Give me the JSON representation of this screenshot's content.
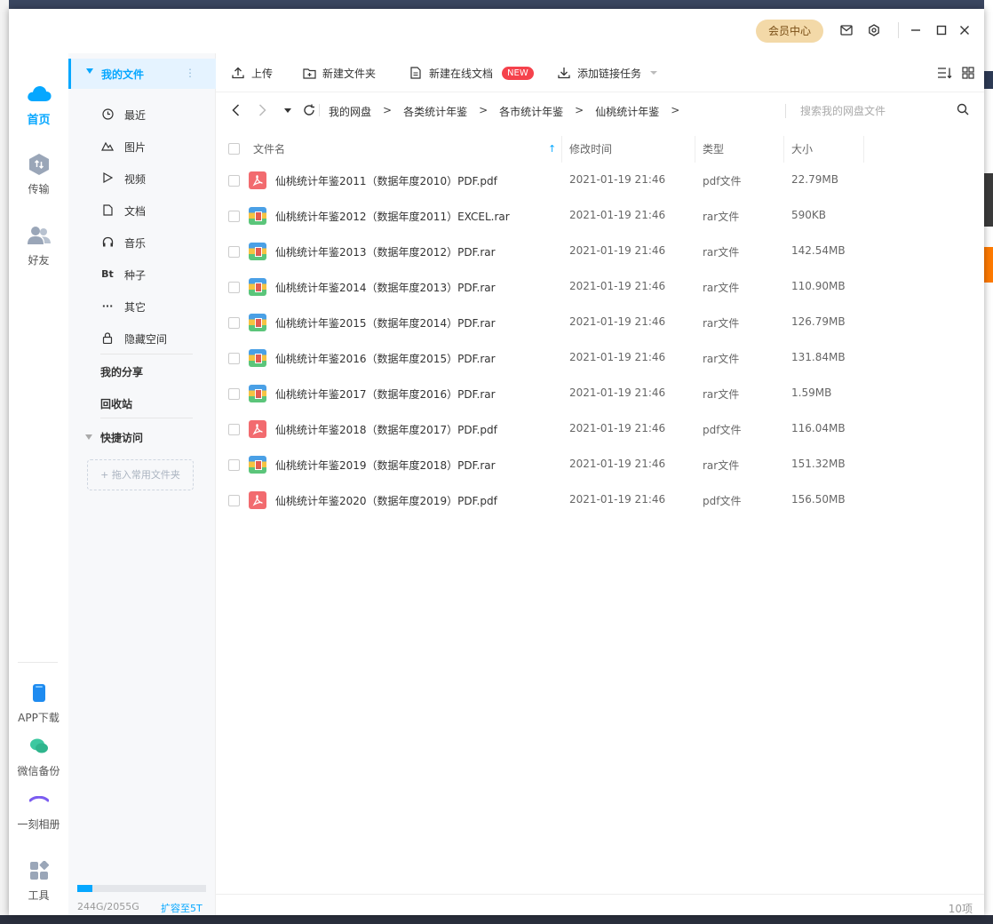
{
  "titlebar": {
    "vip_label": "会员中心"
  },
  "leftnav": {
    "items": [
      {
        "label": "首页",
        "icon": "cloud-icon"
      },
      {
        "label": "传输",
        "icon": "transfer-icon"
      },
      {
        "label": "好友",
        "icon": "friends-icon"
      }
    ],
    "bottom_items": [
      {
        "label": "APP下载",
        "icon": "phone-icon"
      },
      {
        "label": "微信备份",
        "icon": "wechat-icon"
      },
      {
        "label": "一刻相册",
        "icon": "album-icon"
      },
      {
        "label": "工具",
        "icon": "tools-icon"
      }
    ]
  },
  "sidebar": {
    "my_files": "我的文件",
    "more": "⋮",
    "categories": [
      {
        "label": "最近",
        "icon": "clock-icon"
      },
      {
        "label": "图片",
        "icon": "image-icon"
      },
      {
        "label": "视频",
        "icon": "video-icon"
      },
      {
        "label": "文档",
        "icon": "document-icon"
      },
      {
        "label": "音乐",
        "icon": "headphones-icon"
      },
      {
        "label": "种子",
        "icon": "bt-icon",
        "glyph": "Bt"
      },
      {
        "label": "其它",
        "icon": "more-icon",
        "glyph": "···"
      },
      {
        "label": "隐藏空间",
        "icon": "lock-icon"
      }
    ],
    "my_share": "我的分享",
    "recycle": "回收站",
    "quick_access": "快捷访问",
    "add_fav": "+ 拖入常用文件夹",
    "quota": {
      "used_text": "244G/2055G",
      "used_fraction": 0.119,
      "upgrade": "扩容至5T"
    }
  },
  "toolbar": {
    "upload": "上传",
    "new_folder": "新建文件夹",
    "new_online_doc": "新建在线文档",
    "new_badge": "NEW",
    "add_link_task": "添加链接任务"
  },
  "path": {
    "crumbs": [
      "我的网盘",
      "各类统计年鉴",
      "各市统计年鉴",
      "仙桃统计年鉴"
    ],
    "search_placeholder": "搜索我的网盘文件"
  },
  "table": {
    "headers": {
      "name": "文件名",
      "modified": "修改时间",
      "type": "类型",
      "size": "大小"
    },
    "rows": [
      {
        "name": "仙桃统计年鉴2011（数据年度2010）PDF.pdf",
        "modified": "2021-01-19 21:46",
        "type": "pdf文件",
        "size": "22.79MB",
        "kind": "pdf"
      },
      {
        "name": "仙桃统计年鉴2012（数据年度2011）EXCEL.rar",
        "modified": "2021-01-19 21:46",
        "type": "rar文件",
        "size": "590KB",
        "kind": "rar"
      },
      {
        "name": "仙桃统计年鉴2013（数据年度2012）PDF.rar",
        "modified": "2021-01-19 21:46",
        "type": "rar文件",
        "size": "142.54MB",
        "kind": "rar"
      },
      {
        "name": "仙桃统计年鉴2014（数据年度2013）PDF.rar",
        "modified": "2021-01-19 21:46",
        "type": "rar文件",
        "size": "110.90MB",
        "kind": "rar"
      },
      {
        "name": "仙桃统计年鉴2015（数据年度2014）PDF.rar",
        "modified": "2021-01-19 21:46",
        "type": "rar文件",
        "size": "126.79MB",
        "kind": "rar"
      },
      {
        "name": "仙桃统计年鉴2016（数据年度2015）PDF.rar",
        "modified": "2021-01-19 21:46",
        "type": "rar文件",
        "size": "131.84MB",
        "kind": "rar"
      },
      {
        "name": "仙桃统计年鉴2017（数据年度2016）PDF.rar",
        "modified": "2021-01-19 21:46",
        "type": "rar文件",
        "size": "1.59MB",
        "kind": "rar"
      },
      {
        "name": "仙桃统计年鉴2018（数据年度2017）PDF.pdf",
        "modified": "2021-01-19 21:46",
        "type": "pdf文件",
        "size": "116.04MB",
        "kind": "pdf"
      },
      {
        "name": "仙桃统计年鉴2019（数据年度2018）PDF.rar",
        "modified": "2021-01-19 21:46",
        "type": "rar文件",
        "size": "151.32MB",
        "kind": "rar"
      },
      {
        "name": "仙桃统计年鉴2020（数据年度2019）PDF.pdf",
        "modified": "2021-01-19 21:46",
        "type": "pdf文件",
        "size": "156.50MB",
        "kind": "pdf"
      }
    ]
  },
  "footer": {
    "count": "10项"
  },
  "colors": {
    "accent": "#06a7ff",
    "new_badge": "#f5424c",
    "vip_bg": "#f3d9a8"
  }
}
